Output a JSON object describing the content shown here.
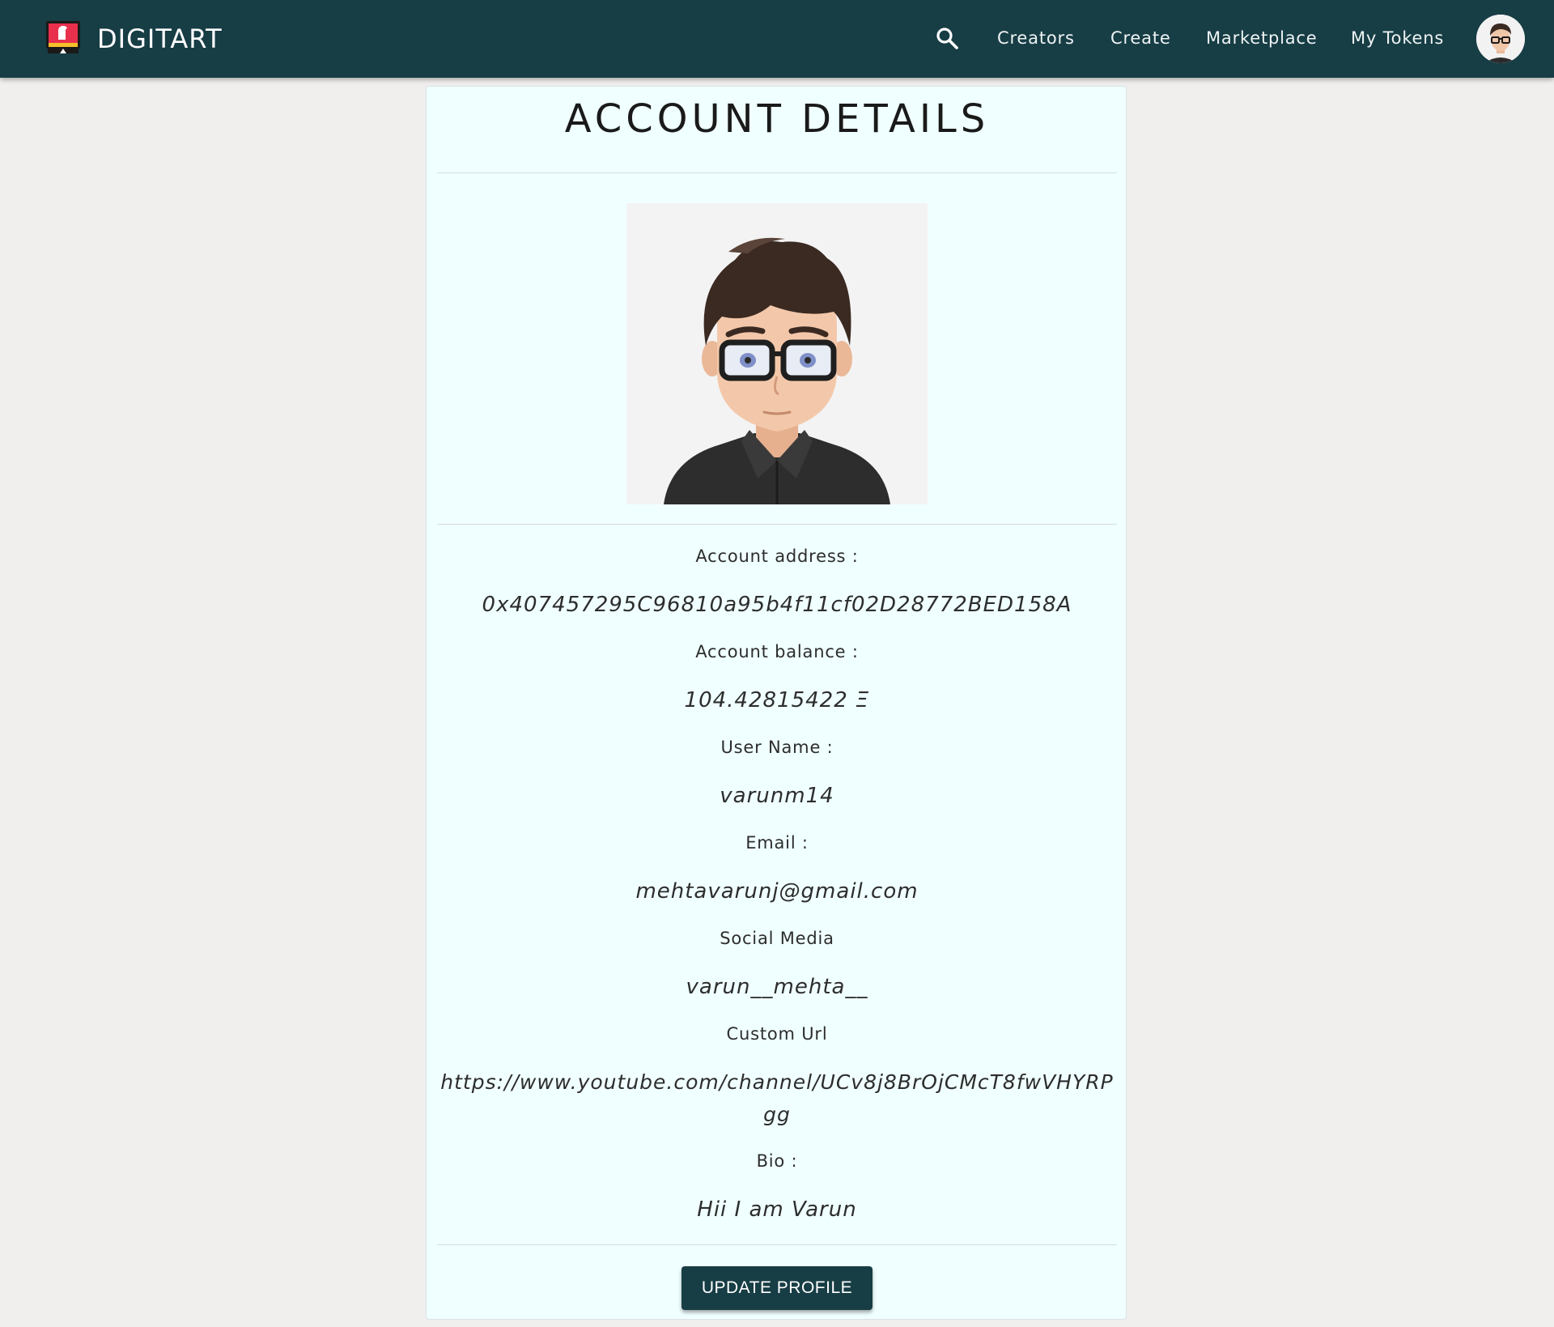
{
  "navbar": {
    "brand_name": "DIGITART",
    "links": {
      "creators": "Creators",
      "create": "Create",
      "marketplace": "Marketplace",
      "my_tokens": "My Tokens"
    },
    "icons": {
      "brand": "digitart-monitor-logo-icon",
      "search": "search-icon",
      "avatar": "user-avatar"
    }
  },
  "account": {
    "title": "ACCOUNT DETAILS",
    "fields": [
      {
        "label": "Account address :",
        "value": "0x407457295C96810a95b4f11cf02D28772BED158A"
      },
      {
        "label": "Account balance :",
        "value": "104.42815422 Ξ"
      },
      {
        "label": "User Name :",
        "value": "varunm14"
      },
      {
        "label": "Email :",
        "value": "mehtavarunj@gmail.com"
      },
      {
        "label": "Social Media",
        "value": "varun__mehta__"
      },
      {
        "label": "Custom Url",
        "value": "https://www.youtube.com/channel/UCv8j8BrOjCMcT8fwVHYRPgg"
      },
      {
        "label": "Bio :",
        "value": "Hii I am Varun"
      }
    ],
    "update_button": "UPDATE PROFILE"
  },
  "colors": {
    "navbar": "#173d45",
    "page_background": "#f0efee",
    "card_background": "#f0ffff",
    "button": "#173d45"
  }
}
